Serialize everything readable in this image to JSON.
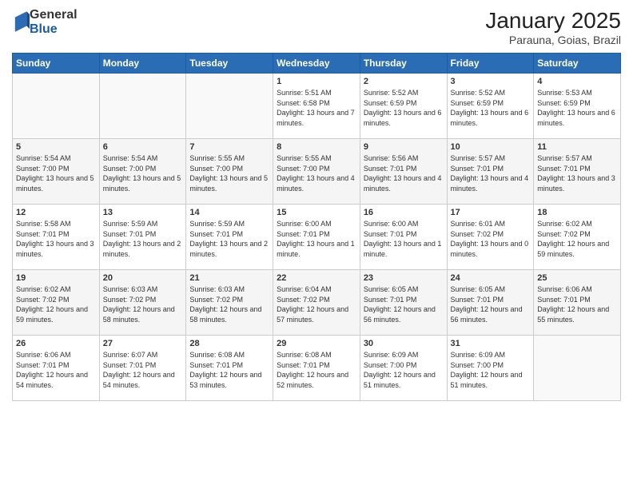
{
  "logo": {
    "general": "General",
    "blue": "Blue"
  },
  "title": "January 2025",
  "subtitle": "Parauna, Goias, Brazil",
  "days_of_week": [
    "Sunday",
    "Monday",
    "Tuesday",
    "Wednesday",
    "Thursday",
    "Friday",
    "Saturday"
  ],
  "weeks": [
    [
      {
        "day": "",
        "sunrise": "",
        "sunset": "",
        "daylight": ""
      },
      {
        "day": "",
        "sunrise": "",
        "sunset": "",
        "daylight": ""
      },
      {
        "day": "",
        "sunrise": "",
        "sunset": "",
        "daylight": ""
      },
      {
        "day": "1",
        "sunrise": "Sunrise: 5:51 AM",
        "sunset": "Sunset: 6:58 PM",
        "daylight": "Daylight: 13 hours and 7 minutes."
      },
      {
        "day": "2",
        "sunrise": "Sunrise: 5:52 AM",
        "sunset": "Sunset: 6:59 PM",
        "daylight": "Daylight: 13 hours and 6 minutes."
      },
      {
        "day": "3",
        "sunrise": "Sunrise: 5:52 AM",
        "sunset": "Sunset: 6:59 PM",
        "daylight": "Daylight: 13 hours and 6 minutes."
      },
      {
        "day": "4",
        "sunrise": "Sunrise: 5:53 AM",
        "sunset": "Sunset: 6:59 PM",
        "daylight": "Daylight: 13 hours and 6 minutes."
      }
    ],
    [
      {
        "day": "5",
        "sunrise": "Sunrise: 5:54 AM",
        "sunset": "Sunset: 7:00 PM",
        "daylight": "Daylight: 13 hours and 5 minutes."
      },
      {
        "day": "6",
        "sunrise": "Sunrise: 5:54 AM",
        "sunset": "Sunset: 7:00 PM",
        "daylight": "Daylight: 13 hours and 5 minutes."
      },
      {
        "day": "7",
        "sunrise": "Sunrise: 5:55 AM",
        "sunset": "Sunset: 7:00 PM",
        "daylight": "Daylight: 13 hours and 5 minutes."
      },
      {
        "day": "8",
        "sunrise": "Sunrise: 5:55 AM",
        "sunset": "Sunset: 7:00 PM",
        "daylight": "Daylight: 13 hours and 4 minutes."
      },
      {
        "day": "9",
        "sunrise": "Sunrise: 5:56 AM",
        "sunset": "Sunset: 7:01 PM",
        "daylight": "Daylight: 13 hours and 4 minutes."
      },
      {
        "day": "10",
        "sunrise": "Sunrise: 5:57 AM",
        "sunset": "Sunset: 7:01 PM",
        "daylight": "Daylight: 13 hours and 4 minutes."
      },
      {
        "day": "11",
        "sunrise": "Sunrise: 5:57 AM",
        "sunset": "Sunset: 7:01 PM",
        "daylight": "Daylight: 13 hours and 3 minutes."
      }
    ],
    [
      {
        "day": "12",
        "sunrise": "Sunrise: 5:58 AM",
        "sunset": "Sunset: 7:01 PM",
        "daylight": "Daylight: 13 hours and 3 minutes."
      },
      {
        "day": "13",
        "sunrise": "Sunrise: 5:59 AM",
        "sunset": "Sunset: 7:01 PM",
        "daylight": "Daylight: 13 hours and 2 minutes."
      },
      {
        "day": "14",
        "sunrise": "Sunrise: 5:59 AM",
        "sunset": "Sunset: 7:01 PM",
        "daylight": "Daylight: 13 hours and 2 minutes."
      },
      {
        "day": "15",
        "sunrise": "Sunrise: 6:00 AM",
        "sunset": "Sunset: 7:01 PM",
        "daylight": "Daylight: 13 hours and 1 minute."
      },
      {
        "day": "16",
        "sunrise": "Sunrise: 6:00 AM",
        "sunset": "Sunset: 7:01 PM",
        "daylight": "Daylight: 13 hours and 1 minute."
      },
      {
        "day": "17",
        "sunrise": "Sunrise: 6:01 AM",
        "sunset": "Sunset: 7:02 PM",
        "daylight": "Daylight: 13 hours and 0 minutes."
      },
      {
        "day": "18",
        "sunrise": "Sunrise: 6:02 AM",
        "sunset": "Sunset: 7:02 PM",
        "daylight": "Daylight: 12 hours and 59 minutes."
      }
    ],
    [
      {
        "day": "19",
        "sunrise": "Sunrise: 6:02 AM",
        "sunset": "Sunset: 7:02 PM",
        "daylight": "Daylight: 12 hours and 59 minutes."
      },
      {
        "day": "20",
        "sunrise": "Sunrise: 6:03 AM",
        "sunset": "Sunset: 7:02 PM",
        "daylight": "Daylight: 12 hours and 58 minutes."
      },
      {
        "day": "21",
        "sunrise": "Sunrise: 6:03 AM",
        "sunset": "Sunset: 7:02 PM",
        "daylight": "Daylight: 12 hours and 58 minutes."
      },
      {
        "day": "22",
        "sunrise": "Sunrise: 6:04 AM",
        "sunset": "Sunset: 7:02 PM",
        "daylight": "Daylight: 12 hours and 57 minutes."
      },
      {
        "day": "23",
        "sunrise": "Sunrise: 6:05 AM",
        "sunset": "Sunset: 7:01 PM",
        "daylight": "Daylight: 12 hours and 56 minutes."
      },
      {
        "day": "24",
        "sunrise": "Sunrise: 6:05 AM",
        "sunset": "Sunset: 7:01 PM",
        "daylight": "Daylight: 12 hours and 56 minutes."
      },
      {
        "day": "25",
        "sunrise": "Sunrise: 6:06 AM",
        "sunset": "Sunset: 7:01 PM",
        "daylight": "Daylight: 12 hours and 55 minutes."
      }
    ],
    [
      {
        "day": "26",
        "sunrise": "Sunrise: 6:06 AM",
        "sunset": "Sunset: 7:01 PM",
        "daylight": "Daylight: 12 hours and 54 minutes."
      },
      {
        "day": "27",
        "sunrise": "Sunrise: 6:07 AM",
        "sunset": "Sunset: 7:01 PM",
        "daylight": "Daylight: 12 hours and 54 minutes."
      },
      {
        "day": "28",
        "sunrise": "Sunrise: 6:08 AM",
        "sunset": "Sunset: 7:01 PM",
        "daylight": "Daylight: 12 hours and 53 minutes."
      },
      {
        "day": "29",
        "sunrise": "Sunrise: 6:08 AM",
        "sunset": "Sunset: 7:01 PM",
        "daylight": "Daylight: 12 hours and 52 minutes."
      },
      {
        "day": "30",
        "sunrise": "Sunrise: 6:09 AM",
        "sunset": "Sunset: 7:00 PM",
        "daylight": "Daylight: 12 hours and 51 minutes."
      },
      {
        "day": "31",
        "sunrise": "Sunrise: 6:09 AM",
        "sunset": "Sunset: 7:00 PM",
        "daylight": "Daylight: 12 hours and 51 minutes."
      },
      {
        "day": "",
        "sunrise": "",
        "sunset": "",
        "daylight": ""
      }
    ]
  ]
}
